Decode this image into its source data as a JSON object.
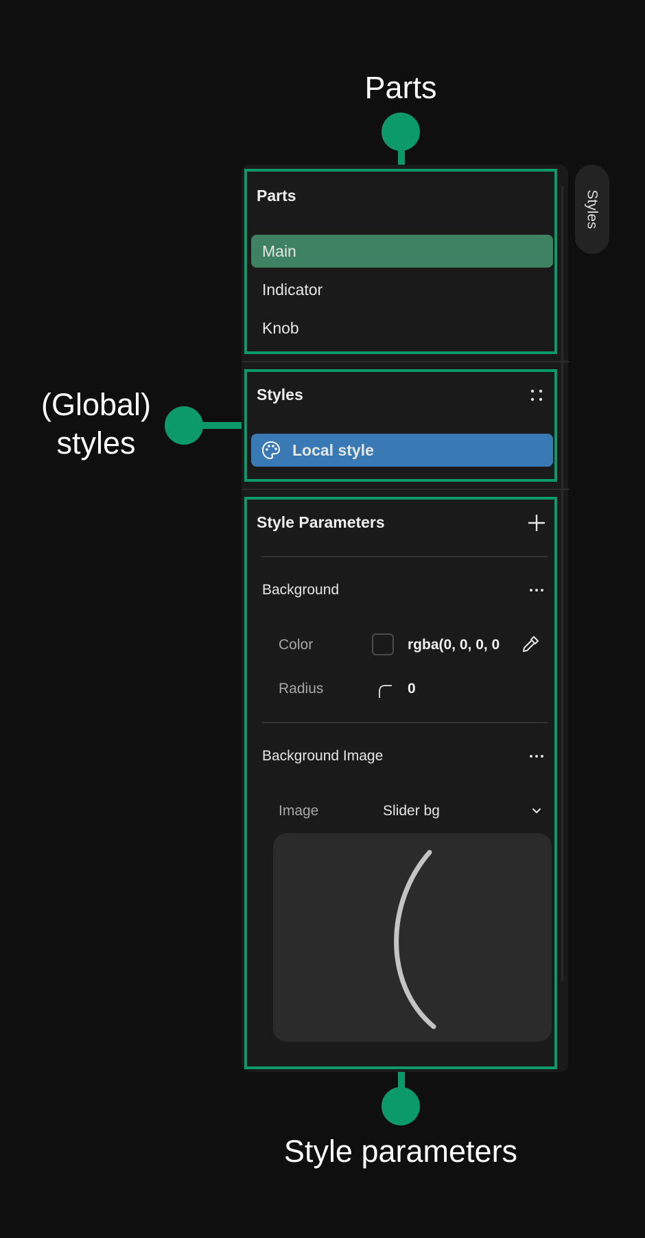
{
  "callouts": {
    "parts": "Parts",
    "global_styles_line1": "(Global)",
    "global_styles_line2": "styles",
    "style_parameters": "Style parameters"
  },
  "side_tab": {
    "label": "Styles"
  },
  "parts_section": {
    "title": "Parts",
    "items": [
      {
        "label": "Main",
        "selected": true
      },
      {
        "label": "Indicator",
        "selected": false
      },
      {
        "label": "Knob",
        "selected": false
      }
    ]
  },
  "styles_section": {
    "title": "Styles",
    "items": [
      {
        "label": "Local style",
        "icon": "palette-icon",
        "selected": true
      }
    ]
  },
  "params_section": {
    "title": "Style Parameters",
    "background": {
      "title": "Background",
      "color_label": "Color",
      "color_value": "rgba(0, 0, 0, 0",
      "radius_label": "Radius",
      "radius_value": "0"
    },
    "background_image": {
      "title": "Background Image",
      "image_label": "Image",
      "image_value": "Slider bg"
    }
  },
  "colors": {
    "highlight": "#0d9a6a",
    "selected_part": "#3e8262",
    "selected_style": "#3a7ab4",
    "panel": "#1a1a1a"
  }
}
